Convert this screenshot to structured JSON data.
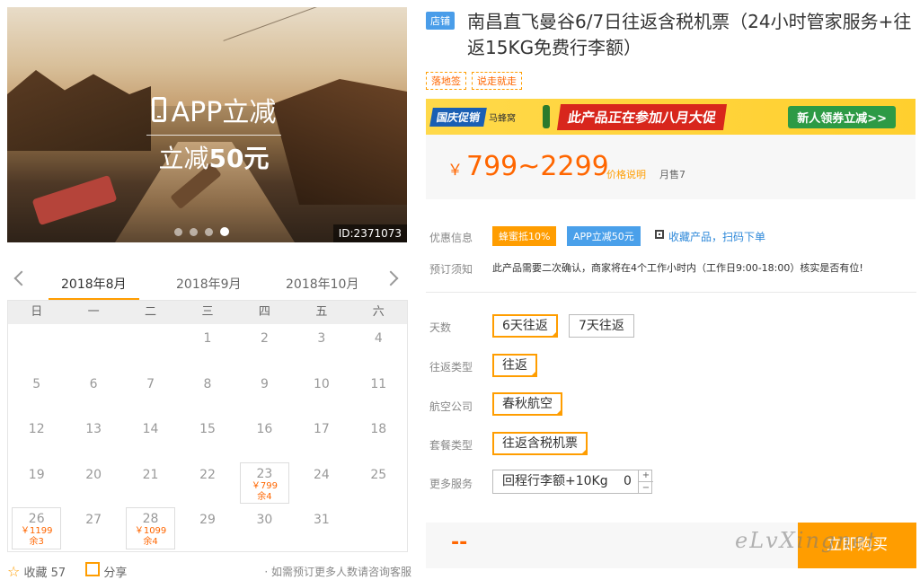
{
  "hero": {
    "promo_line1": "APP立减",
    "promo_line2_prefix": "立减",
    "promo_line2_amount": "50元",
    "image_id": "ID:2371073",
    "dots": 4,
    "active_dot": 3
  },
  "calendar": {
    "tabs": [
      "2018年8月",
      "2018年9月",
      "2018年10月"
    ],
    "active_tab": 0,
    "weekdays": [
      "日",
      "一",
      "二",
      "三",
      "四",
      "五",
      "六"
    ],
    "weeks": [
      [
        {
          "d": ""
        },
        {
          "d": ""
        },
        {
          "d": ""
        },
        {
          "d": "1"
        },
        {
          "d": "2"
        },
        {
          "d": "3"
        },
        {
          "d": "4"
        }
      ],
      [
        {
          "d": "5"
        },
        {
          "d": "6"
        },
        {
          "d": "7"
        },
        {
          "d": "8"
        },
        {
          "d": "9"
        },
        {
          "d": "10"
        },
        {
          "d": "11"
        }
      ],
      [
        {
          "d": "12"
        },
        {
          "d": "13"
        },
        {
          "d": "14"
        },
        {
          "d": "15"
        },
        {
          "d": "16"
        },
        {
          "d": "17"
        },
        {
          "d": "18"
        }
      ],
      [
        {
          "d": "19"
        },
        {
          "d": "20"
        },
        {
          "d": "21"
        },
        {
          "d": "22"
        },
        {
          "d": "23",
          "price": "￥799",
          "left": "余4"
        },
        {
          "d": "24"
        },
        {
          "d": "25"
        }
      ],
      [
        {
          "d": "26",
          "price": "￥1199",
          "left": "余3"
        },
        {
          "d": "27"
        },
        {
          "d": "28",
          "price": "￥1099",
          "left": "余4"
        },
        {
          "d": "29"
        },
        {
          "d": "30"
        },
        {
          "d": "31"
        },
        {
          "d": ""
        }
      ]
    ]
  },
  "actions": {
    "favorite": "收藏 57",
    "share": "分享",
    "consult": "· 如需预订更多人数请咨询客服"
  },
  "product": {
    "shop_badge": "店铺",
    "title": "南昌直飞曼谷6/7日往返含税机票（24小时管家服务+往返15KG免费行李额）",
    "tags": [
      "落地签",
      "说走就走"
    ]
  },
  "banner": {
    "logo": "国庆促销",
    "sub": "马蜂窝",
    "main": "此产品正在参加八月大促",
    "coupon": "新人领券立减>>"
  },
  "price": {
    "yen": "￥",
    "range": "799~2299",
    "note": "价格说明",
    "sold": "月售7"
  },
  "info": {
    "discount_label": "优惠信息",
    "discount_badge1": "蜂蜜抵10%",
    "discount_badge2": "APP立减50元",
    "qr_link": "收藏产品，扫码下单",
    "notice_label": "预订须知",
    "notice_text": "此产品需要二次确认，商家将在4个工作小时内（工作日9:00-18:00）核实是否有位!"
  },
  "options": {
    "days_label": "天数",
    "days": [
      "6天往返",
      "7天往返"
    ],
    "days_selected": 0,
    "trip_label": "往返类型",
    "trip": "往返",
    "airline_label": "航空公司",
    "airline": "春秋航空",
    "package_label": "套餐类型",
    "package": "往返含税机票",
    "service_label": "更多服务",
    "service_name": "回程行李额+10Kg",
    "service_qty": "0",
    "plus": "+",
    "minus": "−"
  },
  "checkout": {
    "total": "--",
    "buy": "立即购买"
  },
  "watermark": "eLvXingnet",
  "colors": {
    "accent": "#ff9d00",
    "price": "#ff6600",
    "link": "#2f89d9",
    "badge_blue": "#4aa0ea"
  }
}
